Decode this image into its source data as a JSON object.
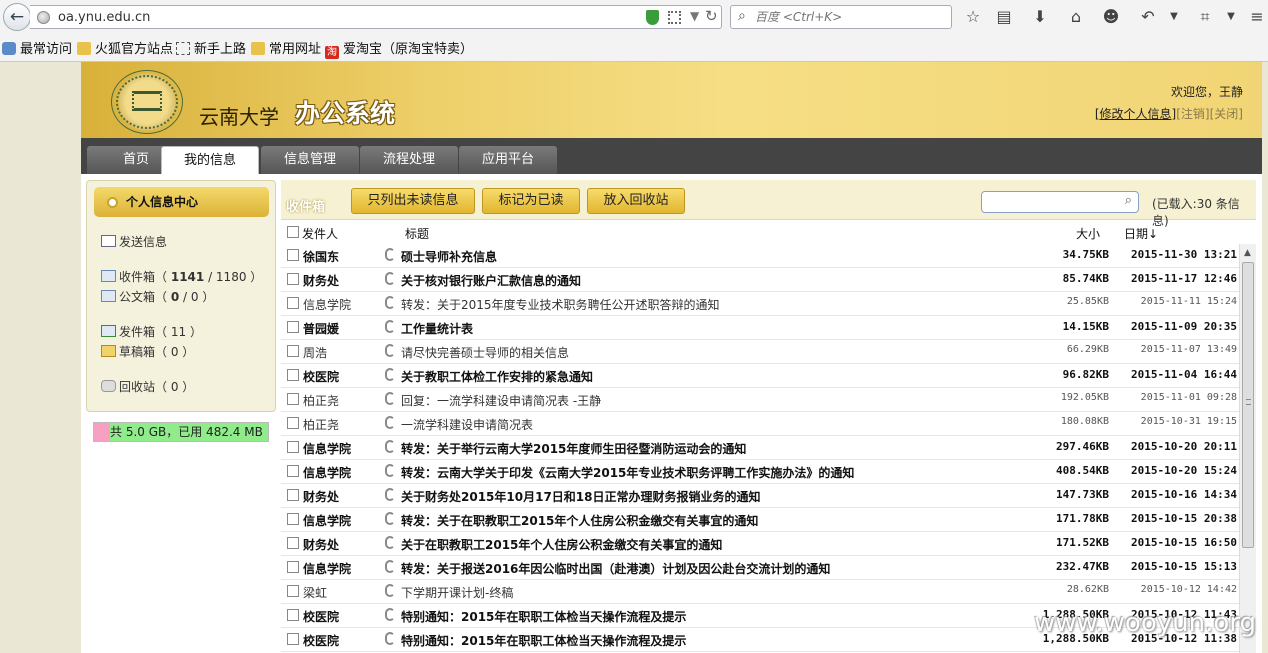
{
  "browser": {
    "url": "oa.ynu.edu.cn",
    "search_placeholder": "百度 <Ctrl+K>",
    "bookmarks": [
      "最常访问",
      "火狐官方站点",
      "新手上路",
      "常用网址",
      "爱淘宝（原淘宝特卖）"
    ]
  },
  "header": {
    "school": "云南大学",
    "system": "办公系统",
    "welcome": "欢迎您，王静",
    "edit_profile": "[修改个人信息]",
    "logout": "[注销]",
    "close": "[关闭]"
  },
  "tabs": [
    "首页",
    "我的信息",
    "信息管理",
    "流程处理",
    "应用平台"
  ],
  "active_tab": "我的信息",
  "sidebar": {
    "title": "个人信息中心",
    "send": "发送信息",
    "inbox_label": "收件箱",
    "inbox_unread": "1141",
    "inbox_total": "1180",
    "doc_label": "公文箱",
    "doc_unread": "0",
    "doc_total": "0",
    "outbox_label": "发件箱",
    "outbox_count": "11",
    "drafts_label": "草稿箱",
    "drafts_count": "0",
    "recycle_label": "回收站",
    "recycle_count": "0",
    "quota_text": "共 5.0 GB，已用 482.4 MB",
    "quota_used_fraction": 0.094
  },
  "inbox": {
    "title": "收件箱",
    "btn_unread": "只列出未读信息",
    "btn_mark_read": "标记为已读",
    "btn_recycle": "放入回收站",
    "loaded_text": "(已载入:30 条信息)",
    "col_from": "发件人",
    "col_subject": "标题",
    "col_size": "大小",
    "col_date": "日期↓",
    "messages": [
      {
        "from": "徐国东",
        "subject": "硕士导师补充信息",
        "size": "34.75KB",
        "date": "2015-11-30 13:21",
        "unread": true
      },
      {
        "from": "财务处",
        "subject": "关于核对银行账户汇款信息的通知",
        "size": "85.74KB",
        "date": "2015-11-17 12:46",
        "unread": true
      },
      {
        "from": "信息学院",
        "subject": "转发：关于2015年度专业技术职务聘任公开述职答辩的通知",
        "size": "25.85KB",
        "date": "2015-11-11 15:24",
        "unread": false
      },
      {
        "from": "普园媛",
        "subject": "工作量统计表",
        "size": "14.15KB",
        "date": "2015-11-09 20:35",
        "unread": true
      },
      {
        "from": "周浩",
        "subject": "请尽快完善硕士导师的相关信息",
        "size": "66.29KB",
        "date": "2015-11-07 13:49",
        "unread": false
      },
      {
        "from": "校医院",
        "subject": "关于教职工体检工作安排的紧急通知",
        "size": "96.82KB",
        "date": "2015-11-04 16:44",
        "unread": true
      },
      {
        "from": "柏正尧",
        "subject": "回复：一流学科建设申请简况表 -王静",
        "size": "192.05KB",
        "date": "2015-11-01 09:28",
        "unread": false
      },
      {
        "from": "柏正尧",
        "subject": "一流学科建设申请简况表",
        "size": "180.08KB",
        "date": "2015-10-31 19:15",
        "unread": false
      },
      {
        "from": "信息学院",
        "subject": "转发：关于举行云南大学2015年度师生田径暨消防运动会的通知",
        "size": "297.46KB",
        "date": "2015-10-20 20:11",
        "unread": true
      },
      {
        "from": "信息学院",
        "subject": "转发：云南大学关于印发《云南大学2015年专业技术职务评聘工作实施办法》的通知",
        "size": "408.54KB",
        "date": "2015-10-20 15:24",
        "unread": true
      },
      {
        "from": "财务处",
        "subject": "关于财务处2015年10月17日和18日正常办理财务报销业务的通知",
        "size": "147.73KB",
        "date": "2015-10-16 14:34",
        "unread": true
      },
      {
        "from": "信息学院",
        "subject": "转发：关于在职教职工2015年个人住房公积金缴交有关事宜的通知",
        "size": "171.78KB",
        "date": "2015-10-15 20:38",
        "unread": true
      },
      {
        "from": "财务处",
        "subject": "关于在职教职工2015年个人住房公积金缴交有关事宜的通知",
        "size": "171.52KB",
        "date": "2015-10-15 16:50",
        "unread": true
      },
      {
        "from": "信息学院",
        "subject": "转发：关于报送2016年因公临时出国（赴港澳）计划及因公赴台交流计划的通知",
        "size": "232.47KB",
        "date": "2015-10-15 15:13",
        "unread": true
      },
      {
        "from": "梁虹",
        "subject": "下学期开课计划-终稿",
        "size": "28.62KB",
        "date": "2015-10-12 14:42",
        "unread": false
      },
      {
        "from": "校医院",
        "subject": "特别通知：2015年在职职工体检当天操作流程及提示",
        "size": "1,288.50KB",
        "date": "2015-10-12 11:43",
        "unread": true
      },
      {
        "from": "校医院",
        "subject": "特别通知：2015年在职职工体检当天操作流程及提示",
        "size": "1,288.50KB",
        "date": "2015-10-12 11:38",
        "unread": true
      }
    ]
  },
  "watermark": "www.wooyun.org"
}
